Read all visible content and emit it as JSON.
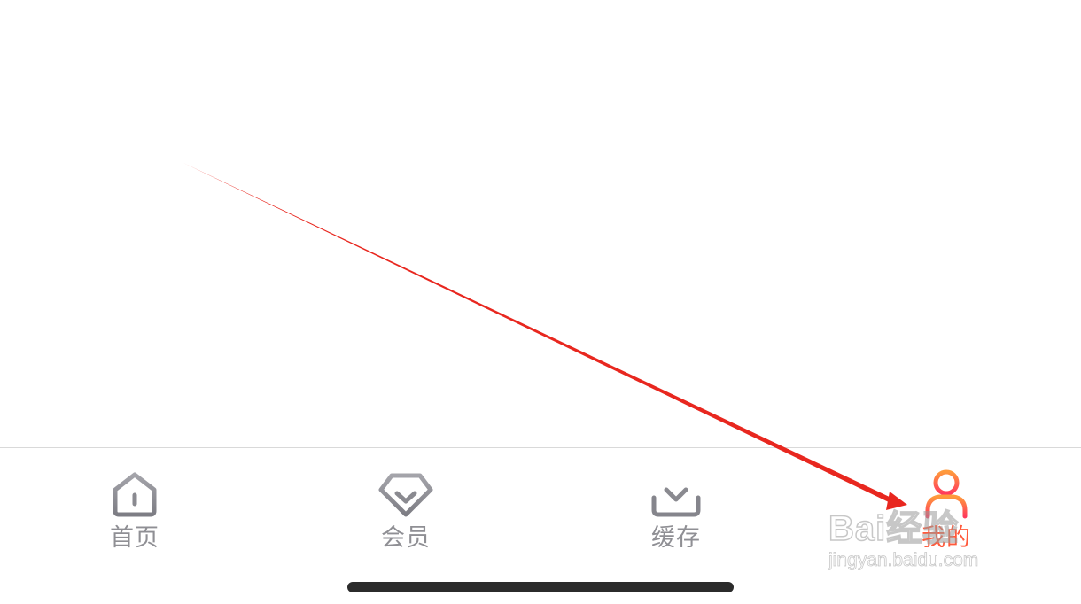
{
  "tabbar": {
    "tabs": [
      {
        "label": "首页",
        "icon": "home-icon"
      },
      {
        "label": "会员",
        "icon": "diamond-icon"
      },
      {
        "label": "缓存",
        "icon": "download-icon"
      },
      {
        "label": "我的",
        "icon": "user-icon"
      }
    ],
    "active_tab": "我的"
  },
  "colors": {
    "inactive": "#8f8f94",
    "active_gradient_start": "#ff9a3c",
    "active_gradient_end": "#ff3b5c",
    "annotation_arrow": "#e8271f"
  },
  "watermark": {
    "line1": "Bai经验",
    "line2": "jingyan.baidu.com"
  }
}
